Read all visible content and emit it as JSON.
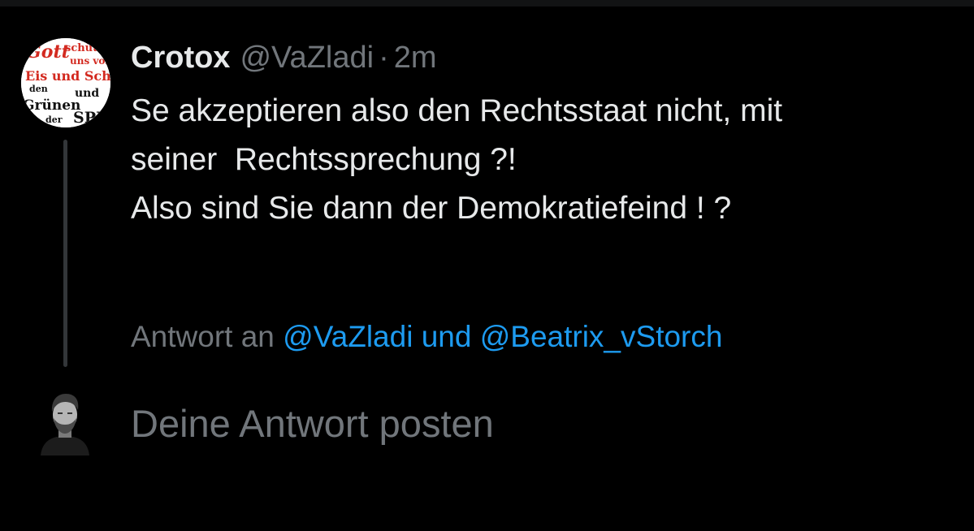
{
  "tweet": {
    "author": {
      "name": "Crotox",
      "handle": "@VaZladi",
      "avatar_text": "Gott schütze uns vor Eis und Schnee. den Grünen und der SPD"
    },
    "separator": "·",
    "time": "2m",
    "text_lines": [
      "Se akzeptieren also den Rechtsstaat nicht, mit",
      "seiner  Rechtssprechung ?!",
      "Also sind Sie dann der Demokratiefeind ! ?"
    ],
    "reply_context": {
      "prefix": "Antwort an",
      "mentions": "@VaZladi und @Beatrix_vStorch"
    }
  },
  "composer": {
    "placeholder": "Deine Antwort posten",
    "avatar_icon": "user-avatar-photo"
  },
  "colors": {
    "background": "#000000",
    "primary_text": "#e7e9ea",
    "secondary_text": "#71767b",
    "link": "#1d9bf0",
    "thread_line": "#333639"
  }
}
